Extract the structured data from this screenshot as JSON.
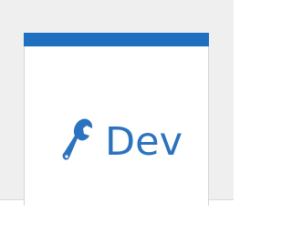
{
  "tile": {
    "label": "Dev",
    "icon": "wrench-icon",
    "accent_color": "#1f6fc1",
    "text_color": "#2b73be"
  }
}
